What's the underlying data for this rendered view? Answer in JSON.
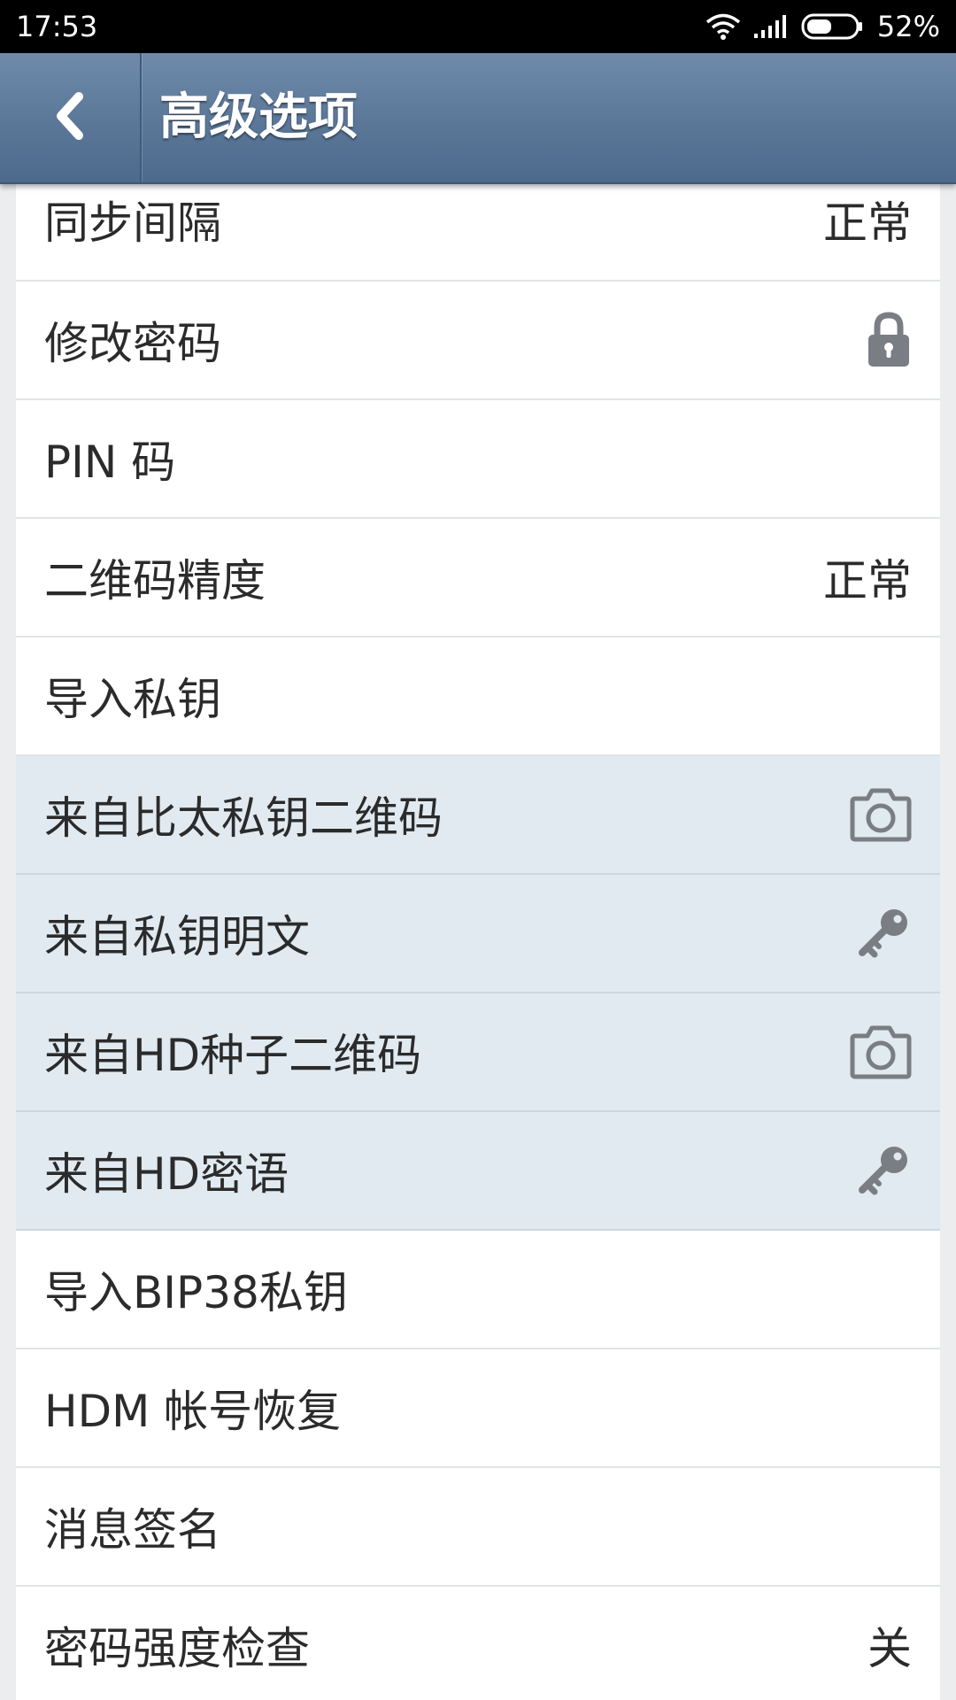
{
  "status_bar": {
    "time": "17:53",
    "battery_percent": "52%",
    "wifi_icon": "wifi-icon",
    "signal_icon": "signal-icon",
    "battery_icon": "battery-icon",
    "battery_level": 0.52
  },
  "header": {
    "back_icon": "chevron-left-icon",
    "title": "高级选项",
    "background_color": "#5b7798"
  },
  "list": {
    "items": [
      {
        "label": "同步间隔",
        "value": "正常"
      },
      {
        "label": "修改密码",
        "icon": "lock-icon"
      },
      {
        "label": "PIN 码"
      },
      {
        "label": "二维码精度",
        "value": "正常"
      },
      {
        "label": "导入私钥"
      },
      {
        "label": "来自比太私钥二维码",
        "icon": "camera-icon",
        "highlighted": true
      },
      {
        "label": "来自私钥明文",
        "icon": "key-icon",
        "highlighted": true
      },
      {
        "label": "来自HD种子二维码",
        "icon": "camera-icon",
        "highlighted": true
      },
      {
        "label": "来自HD密语",
        "icon": "key-icon",
        "highlighted": true
      },
      {
        "label": "导入BIP38私钥"
      },
      {
        "label": "HDM 帐号恢复"
      },
      {
        "label": "消息签名"
      },
      {
        "label": "密码强度检查",
        "value": "关"
      }
    ]
  },
  "colors": {
    "highlight_row": "#e1eaf1",
    "icon_gray": "#7a7e84",
    "text": "#2b2b2b"
  }
}
